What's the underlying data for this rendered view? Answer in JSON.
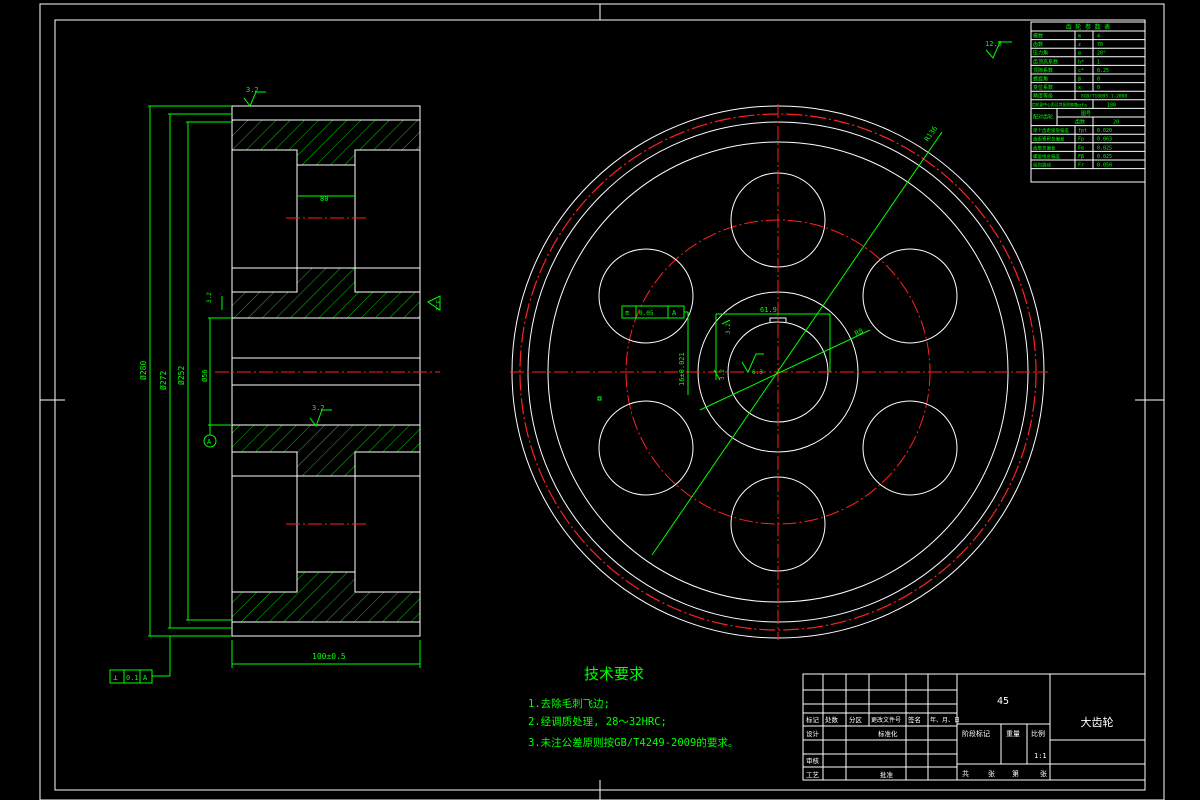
{
  "dimensions": {
    "width_total": "100±0.5",
    "hub_width": "80",
    "da": "Ø280",
    "df_tol": "Ø272",
    "d": "Ø252",
    "bore": "Ø56",
    "keyway_height": "61.9",
    "keyway_width": "16±0.021",
    "radius_large": "R136",
    "radius_small": "R8"
  },
  "roughness": {
    "top": "3.2",
    "bore_left": "3.2",
    "bore_right": "3.2",
    "hub": "3.2",
    "keyway_a": "3.2",
    "keyway_b": "6.3",
    "general": "12.5"
  },
  "tolerances": {
    "runout": "0.1",
    "runout_datum": "A",
    "symmetry": "0.05",
    "symmetry_datum": "A",
    "datum": "A"
  },
  "params_table": {
    "title": "齿 轮 参 数 表",
    "rows": [
      [
        "模数",
        "m",
        "4"
      ],
      [
        "齿数",
        "z",
        "70"
      ],
      [
        "压力角",
        "α",
        "20°"
      ],
      [
        "齿顶高系数",
        "h*",
        "1"
      ],
      [
        "顶隙系数",
        "c*",
        "0.25"
      ],
      [
        "螺旋角",
        "β",
        "0"
      ],
      [
        "变位系数",
        "x",
        "0"
      ]
    ],
    "accuracy_label": "精度等级",
    "accuracy_value": "8GB/T10095.1-2008",
    "center_label": "齿轮副中心距及其极限偏差",
    "center_value": "a±fa",
    "center_num": "180",
    "mate_label": "配对齿轮",
    "mate_sub1": "图号",
    "mate_sub2": "齿数",
    "mate_teeth": "20",
    "check_rows": [
      [
        "单个齿距极限偏差",
        "fpt",
        "0.020"
      ],
      [
        "齿距累积总偏差",
        "Fp",
        "0.063"
      ],
      [
        "齿廓总偏差",
        "Fα",
        "0.025"
      ],
      [
        "螺旋线总偏差",
        "Fβ",
        "0.025"
      ],
      [
        "径向跳动",
        "Fr",
        "0.050"
      ]
    ]
  },
  "tech_requirements": {
    "heading": "技术要求",
    "items": [
      "1.去除毛刺飞边;",
      "2.经调质处理, 28～32HRC;",
      "3.未注公差原则按GB/T4249-2009的要求。"
    ]
  },
  "title_block": {
    "material": "45",
    "part_name": "大齿轮",
    "scale_label": "比例",
    "scale_value": "1:1",
    "stage_label": "阶段标记",
    "weight_label": "重量",
    "labels": [
      "标记",
      "处数",
      "分区",
      "更改文件号",
      "签名",
      "年、月、日"
    ],
    "design": "设计",
    "standard": "标准化",
    "review": "审核",
    "process": "工艺",
    "approve": "批准",
    "sheet_total": "共",
    "sheet_label": "张",
    "sheet_num": "第",
    "sheet_label2": "张"
  },
  "colors": {
    "geometry": "#ffffff",
    "annotation": "#00ff00",
    "centerline": "#ff2020"
  }
}
